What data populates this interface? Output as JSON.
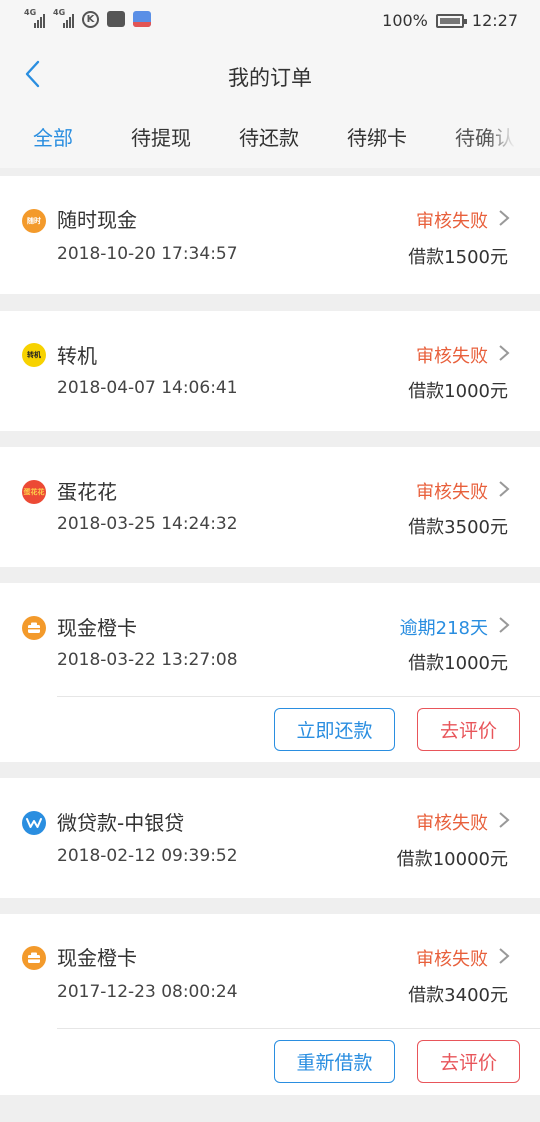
{
  "status_bar": {
    "net1": "4G",
    "net2": "4G",
    "k_label": "K",
    "battery": "100%",
    "time": "12:27"
  },
  "header": {
    "title": "我的订单"
  },
  "tabs": [
    {
      "label": "全部"
    },
    {
      "label": "待提现"
    },
    {
      "label": "待还款"
    },
    {
      "label": "待绑卡"
    },
    {
      "label": "待确认"
    }
  ],
  "orders": [
    {
      "name": "随时现金",
      "date": "2018-10-20 17:34:57",
      "status": "审核失败",
      "amount": "借款1500元",
      "icon": "suishi-xianjin-logo",
      "icon_text": "随时"
    },
    {
      "name": "转机",
      "date": "2018-04-07 14:06:41",
      "status": "审核失败",
      "amount": "借款1000元",
      "icon": "zhuanji-logo",
      "icon_text": "转机"
    },
    {
      "name": "蛋花花",
      "date": "2018-03-25 14:24:32",
      "status": "审核失败",
      "amount": "借款3500元",
      "icon": "danhuahua-logo",
      "icon_text": "蛋花花"
    },
    {
      "name": "现金橙卡",
      "date": "2018-03-22 13:27:08",
      "status": "逾期218天",
      "amount": "借款1000元",
      "icon": "xianjin-chengka-logo",
      "buttons": {
        "primary": "立即还款",
        "secondary": "去评价"
      }
    },
    {
      "name": "微贷款-中银贷",
      "date": "2018-02-12 09:39:52",
      "status": "审核失败",
      "amount": "借款10000元",
      "icon": "weidaikuan-logo"
    },
    {
      "name": "现金橙卡",
      "date": "2017-12-23 08:00:24",
      "status": "审核失败",
      "amount": "借款3400元",
      "icon": "xianjin-chengka-logo",
      "buttons": {
        "primary": "重新借款",
        "secondary": "去评价"
      }
    }
  ],
  "colors": {
    "accent": "#2a8ee0",
    "fail": "#e8603c",
    "button_red": "#e8555a"
  }
}
